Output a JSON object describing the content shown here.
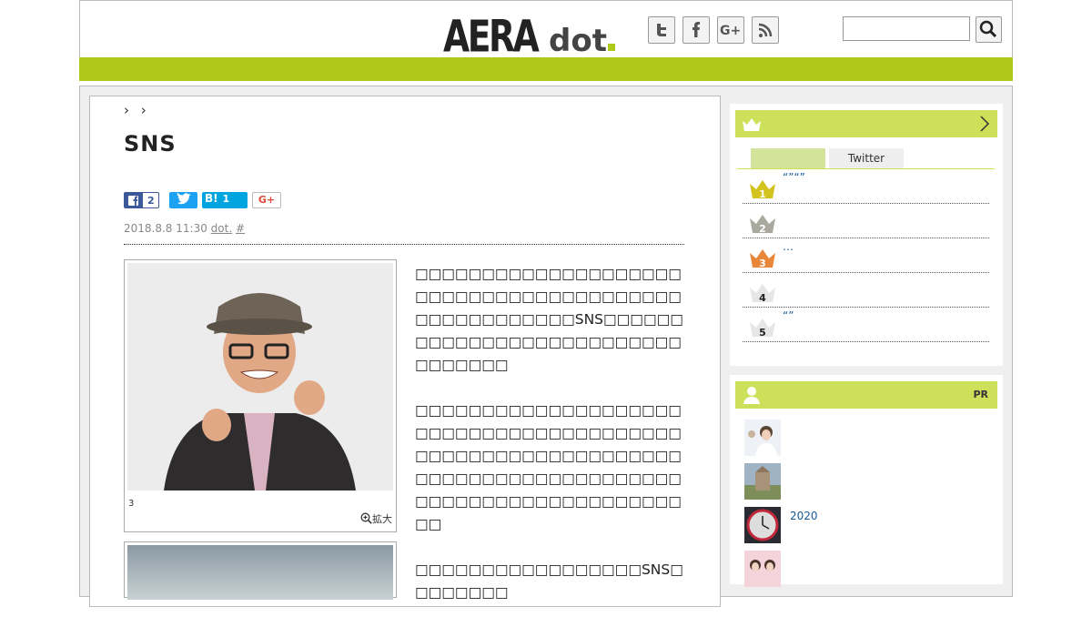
{
  "header": {
    "logo_text": "AERAdot.",
    "social_icons": [
      "twitter-icon",
      "facebook-icon",
      "google-plus-icon",
      "rss-icon"
    ],
    "search_value": ""
  },
  "colors": {
    "brand_green": "#aec919",
    "light_green": "#cde05a",
    "facebook": "#3b5998",
    "twitter": "#1da1f2",
    "hatena": "#00a4de"
  },
  "breadcrumb": {
    "sep1": "›",
    "sep2": "›"
  },
  "article": {
    "title": "SNS",
    "share": {
      "fb_count": "2",
      "hatena_label": "B!",
      "hatena_count": "1",
      "gplus_label": "G+"
    },
    "date": "2018.8.8 11:30",
    "source": "dot.",
    "hash": "#",
    "caption": "3",
    "zoom_label": "拡大",
    "paragraphs": [
      "□□□□□□□□□□□□□□□□□□□□□□□□□□□□□□□□□□□□□□□□□□□□□□□□□□□□SNS□□□□□□□□□□□□□□□□□□□□□□□□□□□□□□□□□",
      "□□□□□□□□□□□□□□□□□□□□□□□□□□□□□□□□□□□□□□□□□□□□□□□□□□□□□□□□□□□□□□□□□□□□□□□□□□□□□□□□□□□□□□□□□□□□□□□□□□□□□□",
      "□□□□□□□□□□□□□□□□□SNS□□□□□□□□"
    ]
  },
  "ranking": {
    "tab_active": "",
    "tab_twitter": "Twitter",
    "items": [
      {
        "rank": "1",
        "text": "“”“”"
      },
      {
        "rank": "2",
        "text": ""
      },
      {
        "rank": "3",
        "text": "…"
      },
      {
        "rank": "4",
        "text": ""
      },
      {
        "rank": "5",
        "text": "“”"
      }
    ]
  },
  "pr": {
    "label": "PR",
    "items": [
      {
        "text": ""
      },
      {
        "text": ""
      },
      {
        "text": "2020"
      },
      {
        "text": ""
      }
    ]
  }
}
